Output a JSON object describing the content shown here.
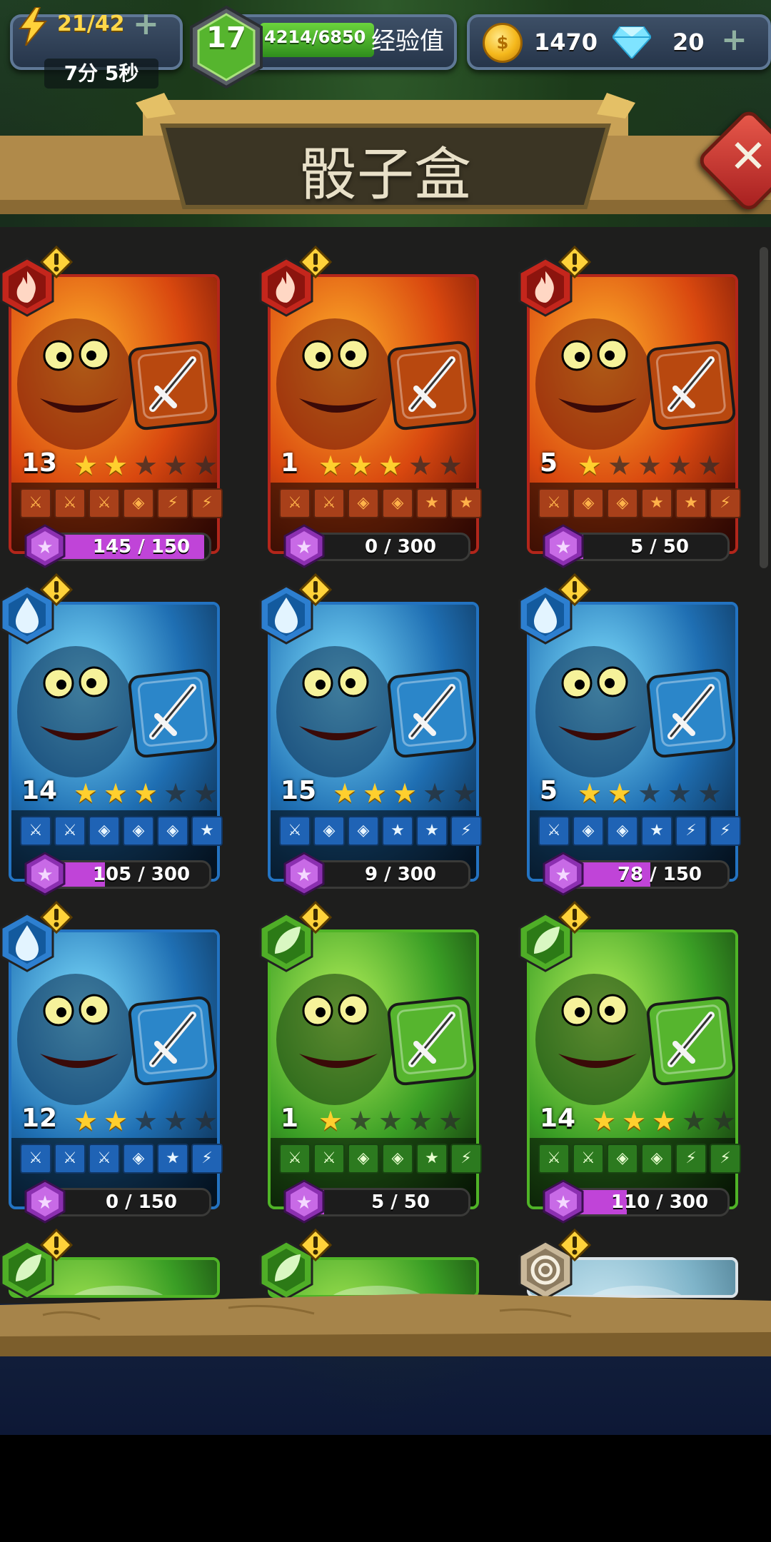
{
  "hud": {
    "energy": "21/42",
    "energy_timer": "7分 5秒",
    "level": "17",
    "xp": "4214/6850",
    "xp_label": "经验值",
    "coins": "1470",
    "gems": "20"
  },
  "page": {
    "title": "骰子盒"
  },
  "colors": {
    "fire_border": "#b3261b",
    "water_border": "#2373c2",
    "nature_border": "#4fb427",
    "neutral_border": "#dbe3e8",
    "progress_fill": "#c044d8",
    "star_on": "#ffcf2e"
  },
  "dice": [
    {
      "element": "fire",
      "level": "13",
      "stars": 2,
      "faces": [
        "sword",
        "sword",
        "sword",
        "shield",
        "bolt",
        "bolt"
      ],
      "progress": "145 / 150",
      "progress_fraction": 0.97
    },
    {
      "element": "fire",
      "level": "1",
      "stars": 3,
      "faces": [
        "sword",
        "sword",
        "shield",
        "shield",
        "star",
        "star"
      ],
      "progress": "0 / 300",
      "progress_fraction": 0
    },
    {
      "element": "fire",
      "level": "5",
      "stars": 1,
      "faces": [
        "sword",
        "shield",
        "shield",
        "star",
        "star",
        "bolt"
      ],
      "progress": "5 / 50",
      "progress_fraction": 0.1
    },
    {
      "element": "water",
      "level": "14",
      "stars": 3,
      "faces": [
        "sword",
        "sword",
        "shield",
        "shield",
        "shield",
        "star"
      ],
      "progress": "105 / 300",
      "progress_fraction": 0.35
    },
    {
      "element": "water",
      "level": "15",
      "stars": 3,
      "faces": [
        "sword",
        "shield",
        "shield",
        "star",
        "star",
        "bolt"
      ],
      "progress": "9 / 300",
      "progress_fraction": 0.03
    },
    {
      "element": "water",
      "level": "5",
      "stars": 2,
      "faces": [
        "sword",
        "shield",
        "shield",
        "star",
        "bolt",
        "bolt"
      ],
      "progress": "78 / 150",
      "progress_fraction": 0.52
    },
    {
      "element": "water",
      "level": "12",
      "stars": 2,
      "faces": [
        "sword",
        "sword",
        "sword",
        "shield",
        "star",
        "bolt"
      ],
      "progress": "0 / 150",
      "progress_fraction": 0
    },
    {
      "element": "nature",
      "level": "1",
      "stars": 1,
      "faces": [
        "sword",
        "sword",
        "shield",
        "shield",
        "star",
        "bolt"
      ],
      "progress": "5 / 50",
      "progress_fraction": 0.1
    },
    {
      "element": "nature",
      "level": "14",
      "stars": 3,
      "faces": [
        "sword",
        "sword",
        "shield",
        "shield",
        "bolt",
        "bolt"
      ],
      "progress": "110 / 300",
      "progress_fraction": 0.37
    },
    {
      "element": "nature"
    },
    {
      "element": "nature"
    },
    {
      "element": "neutral"
    }
  ],
  "icons": {
    "energy": "lightning-bolt-icon",
    "level": "hexagon-level-badge",
    "coin": "coin-icon",
    "gem": "diamond-gem-icon",
    "close": "close-icon",
    "fire": "flame-icon",
    "water": "water-drop-icon",
    "nature": "leaf-icon",
    "neutral": "spiral-icon",
    "alert": "exclamation-icon"
  }
}
